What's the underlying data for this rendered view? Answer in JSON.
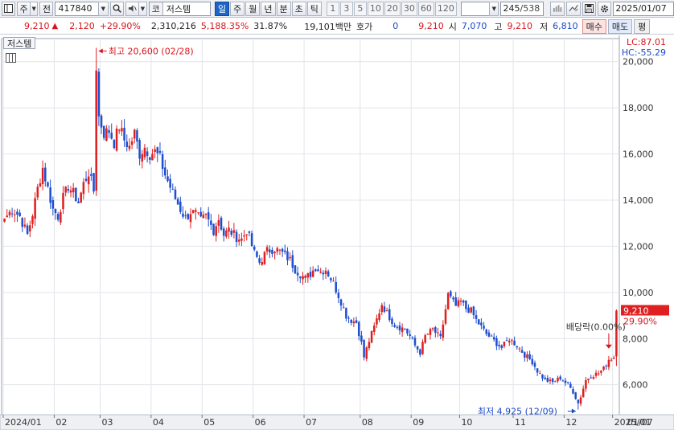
{
  "toolbar": {
    "market_label": "주",
    "prev_label": "전",
    "stock_code": "417840",
    "stock_market": "코",
    "stock_name": "저스템",
    "periods": [
      "일",
      "주",
      "월",
      "년",
      "분",
      "초",
      "틱"
    ],
    "active_period": "일",
    "intervals": [
      "1",
      "3",
      "5",
      "10",
      "20",
      "30",
      "60",
      "120"
    ],
    "view_count": "245",
    "total_count": "/538",
    "date": "2025/01/07"
  },
  "quote": {
    "price": "9,210",
    "change": "2,120",
    "change_pct": "+29.90%",
    "volume": "2,310,216",
    "volume_pct": "5,188.35%",
    "turnover": "31.87%",
    "amount": "19,101백만",
    "hoga_label": "호가",
    "hoga_value": "0",
    "hoga_price": "9,210",
    "open_label": "시",
    "open": "7,070",
    "high_label": "고",
    "high": "9,210",
    "low_label": "저",
    "low": "6,810",
    "buy_label": "매수",
    "sell_label": "매도",
    "extra_label": "평"
  },
  "chart_data": {
    "type": "candlestick",
    "title": "저스템",
    "up_color": "#e02020",
    "down_color": "#1f4fd0",
    "ylim": [
      4700,
      21000
    ],
    "y_ticks": [
      6000,
      8000,
      10000,
      12000,
      14000,
      16000,
      18000,
      20000
    ],
    "y_tick_labels": [
      "6,000",
      "8,000",
      "10,000",
      "12,000",
      "14,000",
      "16,000",
      "18,000",
      "20,000"
    ],
    "x_tick_labels": [
      "2024/01",
      "02",
      "03",
      "04",
      "05",
      "06",
      "07",
      "08",
      "09",
      "10",
      "11",
      "12",
      "2025/01"
    ],
    "x_tick_index": [
      0,
      20,
      38,
      58,
      78,
      98,
      118,
      140,
      160,
      179,
      200,
      220,
      239
    ],
    "right_date_label": "01/07",
    "lc_label": "LC:87.01",
    "hc_label": "HC:-55.29",
    "current_price_label": "9,210",
    "current_change_label": "29.90%",
    "current_price": 9210,
    "annotations": {
      "high": {
        "label": "최고 20,600 (02/28)",
        "value": 20600,
        "index": 36
      },
      "low": {
        "label": "최저 4,925 (12/09)",
        "value": 4925,
        "index": 225
      },
      "dividend": {
        "label": "배당락(0.00%)",
        "value": 7600,
        "index": 237
      }
    },
    "close_anchors": [
      [
        0,
        13200
      ],
      [
        3,
        13600
      ],
      [
        6,
        13300
      ],
      [
        9,
        12500
      ],
      [
        11,
        13400
      ],
      [
        13,
        14500
      ],
      [
        15,
        15400
      ],
      [
        17,
        14500
      ],
      [
        19,
        13600
      ],
      [
        21,
        13300
      ],
      [
        23,
        14100
      ],
      [
        25,
        14600
      ],
      [
        27,
        14300
      ],
      [
        29,
        13900
      ],
      [
        31,
        14700
      ],
      [
        33,
        15200
      ],
      [
        35,
        14400
      ],
      [
        36,
        19800
      ],
      [
        37,
        17600
      ],
      [
        39,
        16900
      ],
      [
        41,
        17000
      ],
      [
        43,
        16500
      ],
      [
        45,
        17200
      ],
      [
        47,
        16600
      ],
      [
        49,
        16300
      ],
      [
        51,
        16900
      ],
      [
        53,
        16000
      ],
      [
        55,
        16300
      ],
      [
        57,
        16000
      ],
      [
        59,
        16100
      ],
      [
        61,
        15800
      ],
      [
        63,
        15100
      ],
      [
        66,
        14300
      ],
      [
        69,
        13600
      ],
      [
        71,
        13200
      ],
      [
        73,
        13500
      ],
      [
        75,
        13400
      ],
      [
        77,
        13100
      ],
      [
        79,
        13300
      ],
      [
        82,
        12700
      ],
      [
        84,
        13200
      ],
      [
        86,
        12500
      ],
      [
        88,
        12700
      ],
      [
        91,
        12400
      ],
      [
        93,
        12300
      ],
      [
        95,
        12700
      ],
      [
        98,
        11700
      ],
      [
        100,
        11300
      ],
      [
        103,
        11800
      ],
      [
        106,
        11900
      ],
      [
        109,
        11700
      ],
      [
        112,
        11400
      ],
      [
        114,
        11000
      ],
      [
        116,
        10800
      ],
      [
        118,
        10600
      ],
      [
        120,
        10800
      ],
      [
        122,
        11100
      ],
      [
        124,
        10900
      ],
      [
        126,
        11000
      ],
      [
        129,
        10400
      ],
      [
        132,
        9600
      ],
      [
        134,
        9000
      ],
      [
        136,
        8800
      ],
      [
        138,
        8700
      ],
      [
        140,
        7800
      ],
      [
        141,
        7200
      ],
      [
        143,
        7900
      ],
      [
        145,
        8500
      ],
      [
        148,
        9500
      ],
      [
        150,
        9100
      ],
      [
        153,
        8600
      ],
      [
        155,
        8500
      ],
      [
        157,
        8400
      ],
      [
        159,
        8100
      ],
      [
        161,
        7700
      ],
      [
        163,
        7400
      ],
      [
        165,
        8100
      ],
      [
        168,
        8400
      ],
      [
        171,
        8000
      ],
      [
        174,
        9900
      ],
      [
        177,
        9400
      ],
      [
        179,
        9600
      ],
      [
        181,
        9300
      ],
      [
        183,
        9200
      ],
      [
        185,
        8800
      ],
      [
        187,
        8500
      ],
      [
        189,
        8200
      ],
      [
        192,
        7900
      ],
      [
        195,
        7600
      ],
      [
        198,
        8000
      ],
      [
        201,
        7700
      ],
      [
        204,
        7300
      ],
      [
        207,
        7000
      ],
      [
        209,
        6600
      ],
      [
        212,
        6200
      ],
      [
        215,
        6100
      ],
      [
        218,
        6300
      ],
      [
        221,
        6000
      ],
      [
        223,
        5700
      ],
      [
        225,
        5200
      ],
      [
        226,
        5500
      ],
      [
        228,
        6200
      ],
      [
        230,
        6400
      ],
      [
        233,
        6500
      ],
      [
        235,
        6700
      ],
      [
        237,
        7100
      ],
      [
        239,
        7200
      ],
      [
        240,
        9210
      ]
    ]
  }
}
